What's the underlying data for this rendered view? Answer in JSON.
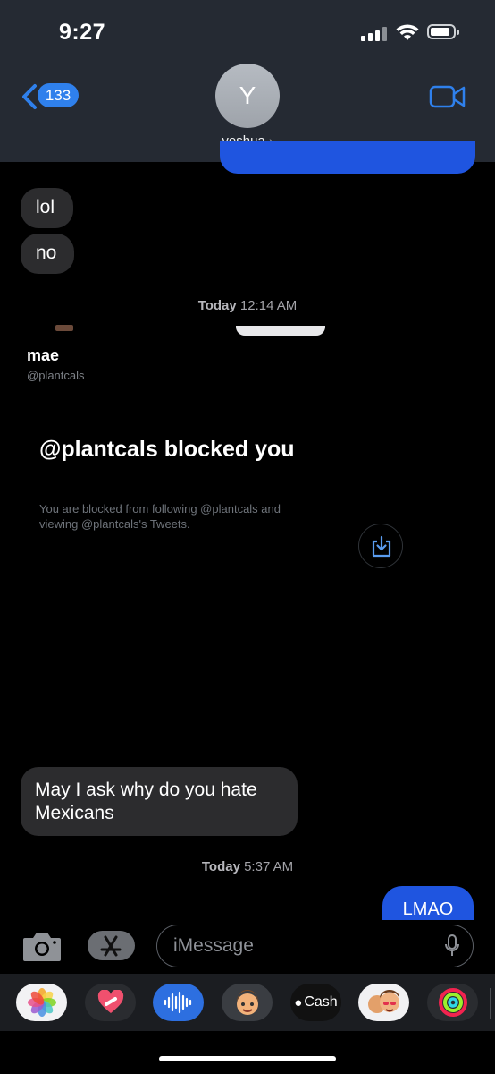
{
  "status": {
    "time": "9:27"
  },
  "header": {
    "back_count": "133",
    "avatar_initial": "Y",
    "contact_name": "yoshua",
    "contact_chevron": "›"
  },
  "messages": {
    "m1": "lol",
    "m2": "no",
    "timestamp1_day": "Today",
    "timestamp1_time": "12:14 AM",
    "m3": "May I ask why do you hate Mexicans",
    "timestamp2_day": "Today",
    "timestamp2_time": "5:37 AM",
    "m4": "LMAO"
  },
  "screenshot": {
    "name": "mae",
    "handle": "@plantcals",
    "blocked_title": "@plantcals blocked you",
    "blocked_desc": "You are blocked from following @plantcals and viewing @plantcals's Tweets."
  },
  "compose": {
    "placeholder": "iMessage"
  },
  "apps": {
    "cash_label": "Cash"
  },
  "colors": {
    "accent": "#2f80ec",
    "sent_bubble": "#1f55e0",
    "received_bubble": "#2c2c2e",
    "header_bg": "#252a33"
  }
}
